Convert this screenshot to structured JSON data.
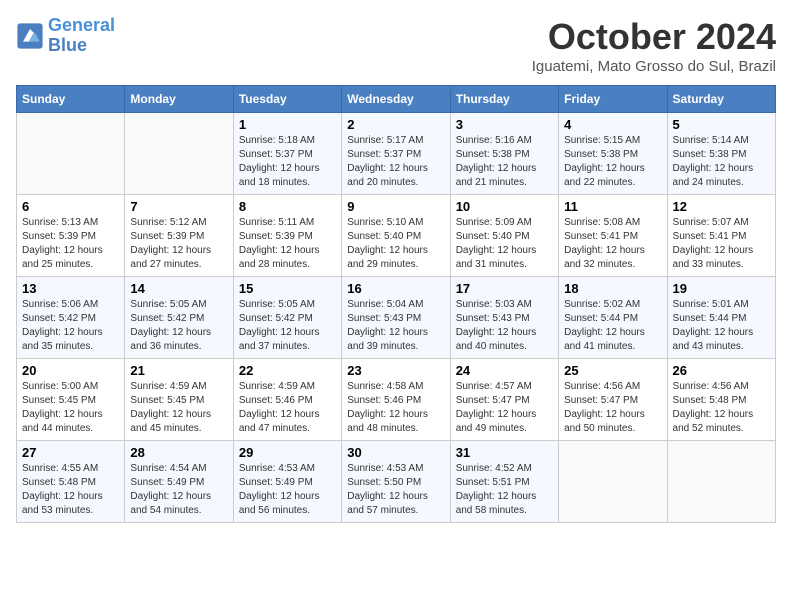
{
  "header": {
    "logo_line1": "General",
    "logo_line2": "Blue",
    "month_title": "October 2024",
    "location": "Iguatemi, Mato Grosso do Sul, Brazil"
  },
  "days_of_week": [
    "Sunday",
    "Monday",
    "Tuesday",
    "Wednesday",
    "Thursday",
    "Friday",
    "Saturday"
  ],
  "weeks": [
    [
      {
        "day": "",
        "sunrise": "",
        "sunset": "",
        "daylight": ""
      },
      {
        "day": "",
        "sunrise": "",
        "sunset": "",
        "daylight": ""
      },
      {
        "day": "1",
        "sunrise": "Sunrise: 5:18 AM",
        "sunset": "Sunset: 5:37 PM",
        "daylight": "Daylight: 12 hours and 18 minutes."
      },
      {
        "day": "2",
        "sunrise": "Sunrise: 5:17 AM",
        "sunset": "Sunset: 5:37 PM",
        "daylight": "Daylight: 12 hours and 20 minutes."
      },
      {
        "day": "3",
        "sunrise": "Sunrise: 5:16 AM",
        "sunset": "Sunset: 5:38 PM",
        "daylight": "Daylight: 12 hours and 21 minutes."
      },
      {
        "day": "4",
        "sunrise": "Sunrise: 5:15 AM",
        "sunset": "Sunset: 5:38 PM",
        "daylight": "Daylight: 12 hours and 22 minutes."
      },
      {
        "day": "5",
        "sunrise": "Sunrise: 5:14 AM",
        "sunset": "Sunset: 5:38 PM",
        "daylight": "Daylight: 12 hours and 24 minutes."
      }
    ],
    [
      {
        "day": "6",
        "sunrise": "Sunrise: 5:13 AM",
        "sunset": "Sunset: 5:39 PM",
        "daylight": "Daylight: 12 hours and 25 minutes."
      },
      {
        "day": "7",
        "sunrise": "Sunrise: 5:12 AM",
        "sunset": "Sunset: 5:39 PM",
        "daylight": "Daylight: 12 hours and 27 minutes."
      },
      {
        "day": "8",
        "sunrise": "Sunrise: 5:11 AM",
        "sunset": "Sunset: 5:39 PM",
        "daylight": "Daylight: 12 hours and 28 minutes."
      },
      {
        "day": "9",
        "sunrise": "Sunrise: 5:10 AM",
        "sunset": "Sunset: 5:40 PM",
        "daylight": "Daylight: 12 hours and 29 minutes."
      },
      {
        "day": "10",
        "sunrise": "Sunrise: 5:09 AM",
        "sunset": "Sunset: 5:40 PM",
        "daylight": "Daylight: 12 hours and 31 minutes."
      },
      {
        "day": "11",
        "sunrise": "Sunrise: 5:08 AM",
        "sunset": "Sunset: 5:41 PM",
        "daylight": "Daylight: 12 hours and 32 minutes."
      },
      {
        "day": "12",
        "sunrise": "Sunrise: 5:07 AM",
        "sunset": "Sunset: 5:41 PM",
        "daylight": "Daylight: 12 hours and 33 minutes."
      }
    ],
    [
      {
        "day": "13",
        "sunrise": "Sunrise: 5:06 AM",
        "sunset": "Sunset: 5:42 PM",
        "daylight": "Daylight: 12 hours and 35 minutes."
      },
      {
        "day": "14",
        "sunrise": "Sunrise: 5:05 AM",
        "sunset": "Sunset: 5:42 PM",
        "daylight": "Daylight: 12 hours and 36 minutes."
      },
      {
        "day": "15",
        "sunrise": "Sunrise: 5:05 AM",
        "sunset": "Sunset: 5:42 PM",
        "daylight": "Daylight: 12 hours and 37 minutes."
      },
      {
        "day": "16",
        "sunrise": "Sunrise: 5:04 AM",
        "sunset": "Sunset: 5:43 PM",
        "daylight": "Daylight: 12 hours and 39 minutes."
      },
      {
        "day": "17",
        "sunrise": "Sunrise: 5:03 AM",
        "sunset": "Sunset: 5:43 PM",
        "daylight": "Daylight: 12 hours and 40 minutes."
      },
      {
        "day": "18",
        "sunrise": "Sunrise: 5:02 AM",
        "sunset": "Sunset: 5:44 PM",
        "daylight": "Daylight: 12 hours and 41 minutes."
      },
      {
        "day": "19",
        "sunrise": "Sunrise: 5:01 AM",
        "sunset": "Sunset: 5:44 PM",
        "daylight": "Daylight: 12 hours and 43 minutes."
      }
    ],
    [
      {
        "day": "20",
        "sunrise": "Sunrise: 5:00 AM",
        "sunset": "Sunset: 5:45 PM",
        "daylight": "Daylight: 12 hours and 44 minutes."
      },
      {
        "day": "21",
        "sunrise": "Sunrise: 4:59 AM",
        "sunset": "Sunset: 5:45 PM",
        "daylight": "Daylight: 12 hours and 45 minutes."
      },
      {
        "day": "22",
        "sunrise": "Sunrise: 4:59 AM",
        "sunset": "Sunset: 5:46 PM",
        "daylight": "Daylight: 12 hours and 47 minutes."
      },
      {
        "day": "23",
        "sunrise": "Sunrise: 4:58 AM",
        "sunset": "Sunset: 5:46 PM",
        "daylight": "Daylight: 12 hours and 48 minutes."
      },
      {
        "day": "24",
        "sunrise": "Sunrise: 4:57 AM",
        "sunset": "Sunset: 5:47 PM",
        "daylight": "Daylight: 12 hours and 49 minutes."
      },
      {
        "day": "25",
        "sunrise": "Sunrise: 4:56 AM",
        "sunset": "Sunset: 5:47 PM",
        "daylight": "Daylight: 12 hours and 50 minutes."
      },
      {
        "day": "26",
        "sunrise": "Sunrise: 4:56 AM",
        "sunset": "Sunset: 5:48 PM",
        "daylight": "Daylight: 12 hours and 52 minutes."
      }
    ],
    [
      {
        "day": "27",
        "sunrise": "Sunrise: 4:55 AM",
        "sunset": "Sunset: 5:48 PM",
        "daylight": "Daylight: 12 hours and 53 minutes."
      },
      {
        "day": "28",
        "sunrise": "Sunrise: 4:54 AM",
        "sunset": "Sunset: 5:49 PM",
        "daylight": "Daylight: 12 hours and 54 minutes."
      },
      {
        "day": "29",
        "sunrise": "Sunrise: 4:53 AM",
        "sunset": "Sunset: 5:49 PM",
        "daylight": "Daylight: 12 hours and 56 minutes."
      },
      {
        "day": "30",
        "sunrise": "Sunrise: 4:53 AM",
        "sunset": "Sunset: 5:50 PM",
        "daylight": "Daylight: 12 hours and 57 minutes."
      },
      {
        "day": "31",
        "sunrise": "Sunrise: 4:52 AM",
        "sunset": "Sunset: 5:51 PM",
        "daylight": "Daylight: 12 hours and 58 minutes."
      },
      {
        "day": "",
        "sunrise": "",
        "sunset": "",
        "daylight": ""
      },
      {
        "day": "",
        "sunrise": "",
        "sunset": "",
        "daylight": ""
      }
    ]
  ]
}
